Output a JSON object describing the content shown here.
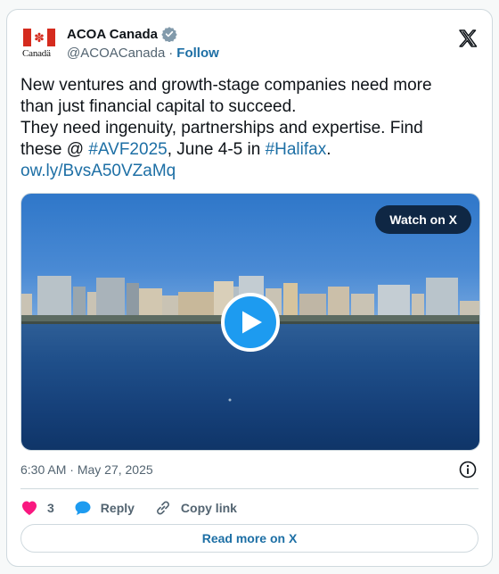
{
  "author": {
    "display_name": "ACOA Canada",
    "handle": "@ACOACanada",
    "separator": "·",
    "follow_label": "Follow",
    "avatar_wordmark": "Canadä"
  },
  "tweet": {
    "line1": "New ventures and growth-stage companies need more than just financial capital to succeed.",
    "line2_prefix": "They need ingenuity, partnerships and expertise. Find these @ ",
    "hashtag1": "#AVF2025",
    "middle_text": ", June 4-5 in ",
    "hashtag2": "#Halifax",
    "end_text": ".",
    "short_link": "ow.ly/BvsA50VZaMq"
  },
  "media": {
    "watch_label": "Watch on X"
  },
  "meta": {
    "time": "6:30 AM",
    "separator": "·",
    "date": "May 27, 2025"
  },
  "actions": {
    "like_count": "3",
    "reply_label": "Reply",
    "copy_label": "Copy link"
  },
  "footer": {
    "read_more_label": "Read more on X"
  },
  "colors": {
    "link": "#1d6fa5",
    "like": "#f91880",
    "reply": "#1d9bf0",
    "play": "#1d9bf0"
  },
  "icons": [
    "verified-icon",
    "x-logo-icon",
    "play-icon",
    "info-icon",
    "heart-icon",
    "reply-bubble-icon",
    "link-icon"
  ]
}
